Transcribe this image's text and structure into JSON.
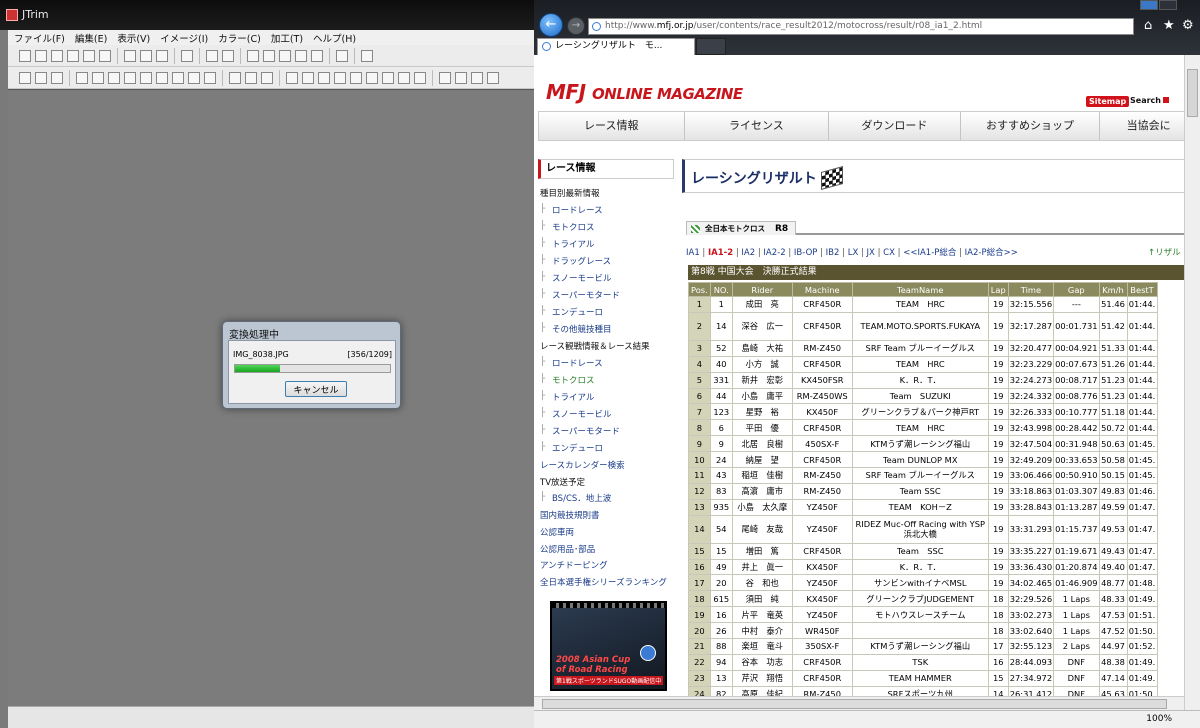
{
  "jtrim": {
    "title": "JTrim",
    "menu": [
      "ファイル(F)",
      "編集(E)",
      "表示(V)",
      "イメージ(I)",
      "カラー(C)",
      "加工(T)",
      "ヘルプ(H)"
    ],
    "dialog": {
      "title": "変換処理中",
      "filename": "IMG_8038.JPG",
      "counter": "[356/1209]",
      "progress": 0.29,
      "cancel": "キャンセル"
    }
  },
  "browser": {
    "url_prefix": "http://www.",
    "url_host": "mfj.or.jp",
    "url_path": "/user/contents/race_result2012/motocross/result/r08_ia1_2.html",
    "tab_title": "レーシングリザルト　モ...",
    "zoom": "100%",
    "icons": [
      "home-icon",
      "star-icon",
      "gear-icon"
    ]
  },
  "site": {
    "logo_main": "MFJ",
    "logo_sub": "ONLINE MAGAZINE",
    "sitemap": "Sitemap",
    "search": "Search",
    "nav": [
      "レース情報",
      "ライセンス",
      "ダウンロード",
      "おすすめショップ",
      "当協会に"
    ]
  },
  "sidebar": {
    "title": "レース情報",
    "items": [
      {
        "label": "種目別最新情報",
        "indent": 0,
        "top": true
      },
      {
        "label": "ロードレース",
        "indent": 1
      },
      {
        "label": "モトクロス",
        "indent": 1
      },
      {
        "label": "トライアル",
        "indent": 1
      },
      {
        "label": "ドラッグレース",
        "indent": 1
      },
      {
        "label": "スノーモービル",
        "indent": 1
      },
      {
        "label": "スーパーモタード",
        "indent": 1
      },
      {
        "label": "エンデューロ",
        "indent": 1
      },
      {
        "label": "その他競技種目",
        "indent": 1
      },
      {
        "label": "レース観戦情報＆レース結果",
        "indent": 0,
        "top": true
      },
      {
        "label": "ロードレース",
        "indent": 1
      },
      {
        "label": "モトクロス",
        "indent": 1,
        "green": true
      },
      {
        "label": "トライアル",
        "indent": 1
      },
      {
        "label": "スノーモービル",
        "indent": 1
      },
      {
        "label": "スーパーモタード",
        "indent": 1
      },
      {
        "label": "エンデューロ",
        "indent": 1
      },
      {
        "label": "レースカレンダー検索",
        "indent": 0
      },
      {
        "label": "TV放送予定",
        "indent": 0,
        "top": true
      },
      {
        "label": "BS/CS．地上波",
        "indent": 1
      },
      {
        "label": "国内競技規則書",
        "indent": 0
      },
      {
        "label": "公認車両",
        "indent": 0
      },
      {
        "label": "公認用品･部品",
        "indent": 0
      },
      {
        "label": "アンチドーピング",
        "indent": 0
      },
      {
        "label": "全日本選手権シリーズランキング",
        "indent": 0
      }
    ],
    "banner_line1": "2008 Asian Cup",
    "banner_line2": "of Road Racing",
    "banner_sub": "第1戦スポーツランドSUGO動画配信中"
  },
  "main": {
    "heading": "レーシングリザルト",
    "tab_label": "全日本モトクロス",
    "tab_round": "R8",
    "classes": [
      {
        "label": "IA1",
        "current": false
      },
      {
        "label": "IA1-2",
        "current": true
      },
      {
        "label": "IA2",
        "current": false
      },
      {
        "label": "IA2-2",
        "current": false
      },
      {
        "label": "IB-OP",
        "current": false
      },
      {
        "label": "IB2",
        "current": false
      },
      {
        "label": "LX",
        "current": false
      },
      {
        "label": "JX",
        "current": false
      },
      {
        "label": "CX",
        "current": false
      },
      {
        "label": "<<IA1-P総合",
        "current": false
      },
      {
        "label": "IA2-P総合>>",
        "current": false
      }
    ],
    "result_link": "↑リザル",
    "round_title": "第8戦 中国大会　決勝正式結果",
    "columns": [
      "Pos.",
      "NO.",
      "Rider",
      "Machine",
      "TeamName",
      "Lap",
      "Time",
      "Gap",
      "Km/h",
      "BestT"
    ],
    "rows": [
      [
        "1",
        "1",
        "成田　亮",
        "CRF450R",
        "TEAM　HRC",
        "19",
        "32:15.556",
        "---",
        "51.46",
        "01:44."
      ],
      [
        "2",
        "14",
        "深谷　広一",
        "CRF450R",
        "TEAM.MOTO.SPORTS.FUKAYA",
        "19",
        "32:17.287",
        "00:01.731",
        "51.42",
        "01:44."
      ],
      [
        "3",
        "52",
        "島崎　大祐",
        "RM-Z450",
        "SRF Team ブルーイーグルス",
        "19",
        "32:20.477",
        "00:04.921",
        "51.33",
        "01:44."
      ],
      [
        "4",
        "40",
        "小方　誠",
        "CRF450R",
        "TEAM　HRC",
        "19",
        "32:23.229",
        "00:07.673",
        "51.26",
        "01:44."
      ],
      [
        "5",
        "331",
        "新井　宏彰",
        "KX450FSR",
        "K．R．T．",
        "19",
        "32:24.273",
        "00:08.717",
        "51.23",
        "01:44."
      ],
      [
        "6",
        "44",
        "小島　庸平",
        "RM-Z450WS",
        "Team　SUZUKI",
        "19",
        "32:24.332",
        "00:08.776",
        "51.23",
        "01:44."
      ],
      [
        "7",
        "123",
        "星野　裕",
        "KX450F",
        "グリーンクラブ＆パーク神戸RT",
        "19",
        "32:26.333",
        "00:10.777",
        "51.18",
        "01:44."
      ],
      [
        "8",
        "6",
        "平田　優",
        "CRF450R",
        "TEAM　HRC",
        "19",
        "32:43.998",
        "00:28.442",
        "50.72",
        "01:44."
      ],
      [
        "9",
        "9",
        "北居　良樹",
        "450SX-F",
        "KTMうず潮レーシング福山",
        "19",
        "32:47.504",
        "00:31.948",
        "50.63",
        "01:45."
      ],
      [
        "10",
        "24",
        "納屋　望",
        "CRF450R",
        "Team DUNLOP MX",
        "19",
        "32:49.209",
        "00:33.653",
        "50.58",
        "01:45."
      ],
      [
        "11",
        "43",
        "稲垣　佳樹",
        "RM-Z450",
        "SRF Team ブルーイーグルス",
        "19",
        "33:06.466",
        "00:50.910",
        "50.15",
        "01:45."
      ],
      [
        "12",
        "83",
        "髙濵　庸市",
        "RM-Z450",
        "Team SSC",
        "19",
        "33:18.863",
        "01:03.307",
        "49.83",
        "01:46."
      ],
      [
        "13",
        "935",
        "小島　太久摩",
        "YZ450F",
        "TEAM　KOH－Z",
        "19",
        "33:28.843",
        "01:13.287",
        "49.59",
        "01:47."
      ],
      [
        "14",
        "54",
        "尾崎　友哉",
        "YZ450F",
        "RIDEZ Muc-Off Racing with YSP浜北大橋",
        "19",
        "33:31.293",
        "01:15.737",
        "49.53",
        "01:47."
      ],
      [
        "15",
        "15",
        "増田　篤",
        "CRF450R",
        "Team　SSC",
        "19",
        "33:35.227",
        "01:19.671",
        "49.43",
        "01:47."
      ],
      [
        "16",
        "49",
        "井上　眞一",
        "KX450F",
        "K．R．T．",
        "19",
        "33:36.430",
        "01:20.874",
        "49.40",
        "01:47."
      ],
      [
        "17",
        "20",
        "谷　和也",
        "YZ450F",
        "サンビンwithイナベMSL",
        "19",
        "34:02.465",
        "01:46.909",
        "48.77",
        "01:48."
      ],
      [
        "18",
        "615",
        "須田　純",
        "KX450F",
        "グリーンクラブJUDGEMENT",
        "18",
        "32:29.526",
        "1 Laps",
        "48.33",
        "01:49."
      ],
      [
        "19",
        "16",
        "片平　竜英",
        "YZ450F",
        "モトハウスレースチーム",
        "18",
        "33:02.273",
        "1 Laps",
        "47.53",
        "01:51."
      ],
      [
        "20",
        "26",
        "中村　泰介",
        "WR450F",
        "",
        "18",
        "33:02.640",
        "1 Laps",
        "47.52",
        "01:50."
      ],
      [
        "21",
        "88",
        "楽垣　竜斗",
        "350SX-F",
        "KTMうず潮レーシング福山",
        "17",
        "32:55.123",
        "2 Laps",
        "44.97",
        "01:52."
      ],
      [
        "22",
        "94",
        "谷本　功志",
        "CRF450R",
        "TSK",
        "16",
        "28:44.093",
        "DNF",
        "48.38",
        "01:49."
      ],
      [
        "23",
        "13",
        "芹沢　翔悟",
        "CRF450R",
        "TEAM HAMMER",
        "15",
        "27:34.972",
        "DNF",
        "47.14",
        "01:49."
      ],
      [
        "24",
        "82",
        "髙原　佳紀",
        "RM-Z450",
        "SRFスポーツ九州",
        "14",
        "26:31.412",
        "DNF",
        "45.63",
        "01:50."
      ]
    ]
  }
}
